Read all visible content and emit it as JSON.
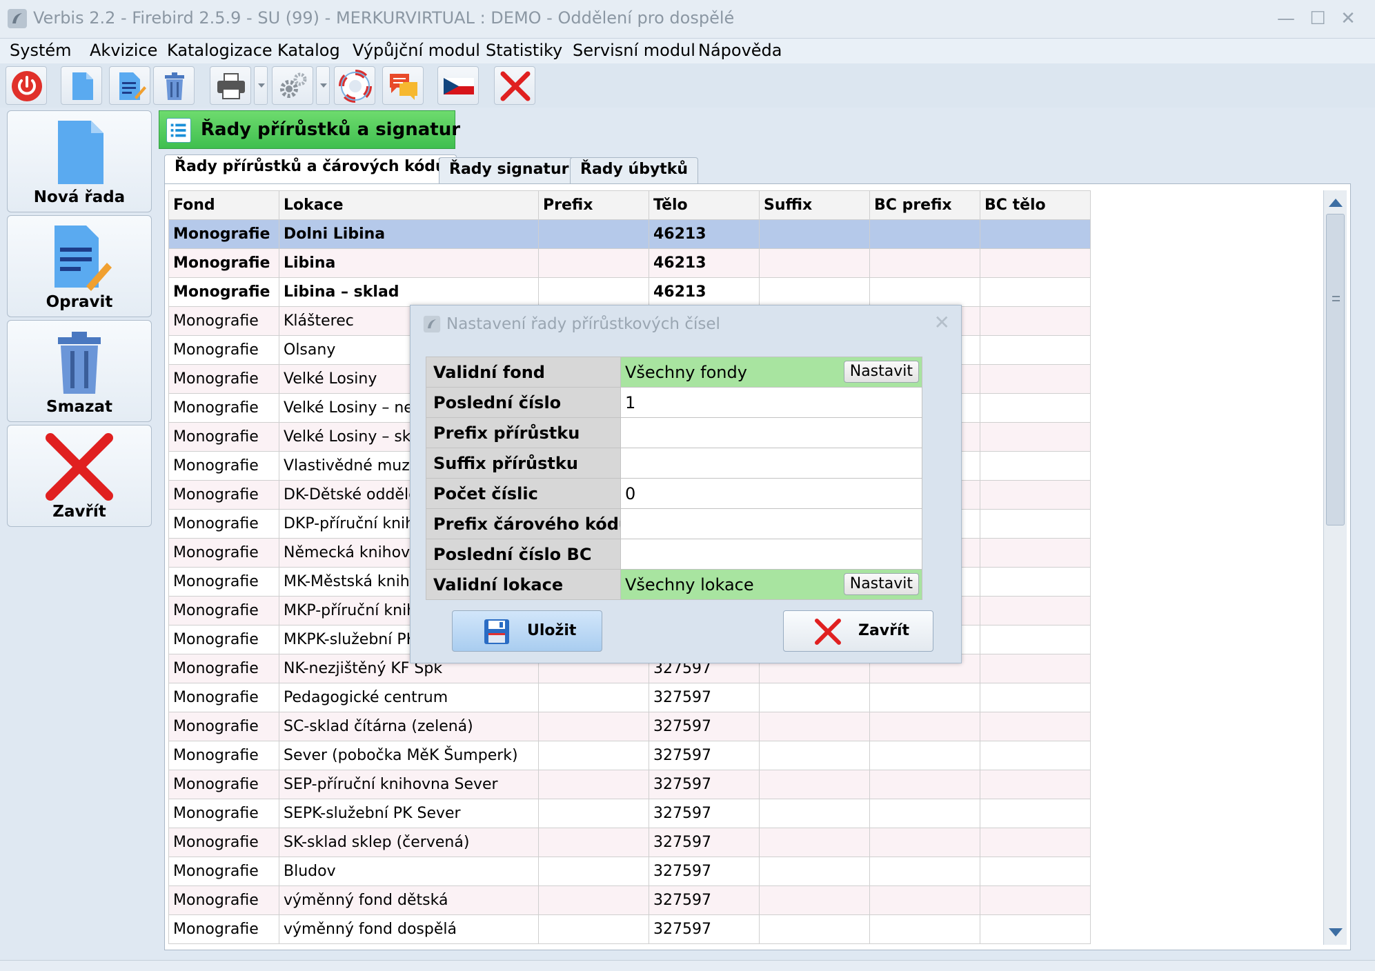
{
  "window": {
    "title": "Verbis 2.2 - Firebird 2.5.9 - SU (99) - MERKURVIRTUAL : DEMO - Oddělení pro dospělé",
    "minimize": "—",
    "maximize": "☐",
    "close": "✕"
  },
  "menu": [
    "Systém",
    "Akvizice",
    "Katalogizace",
    "Katalog",
    "Výpůjční modul",
    "Statistiky",
    "Servisní modul",
    "Nápověda"
  ],
  "side_buttons": {
    "new": "Nová řada",
    "edit": "Opravit",
    "delete": "Smazat",
    "close": "Zavřít"
  },
  "section_title": "Řady přírůstků a signatur",
  "tabs": [
    "Řady přírůstků a čárových kódů",
    "Řady signatur",
    "Řady úbytků"
  ],
  "grid": {
    "columns": [
      "Fond",
      "Lokace",
      "Prefix",
      "Tělo",
      "Suffix",
      "BC prefix",
      "BC tělo"
    ],
    "rows": [
      [
        "Monografie",
        "Dolni Libina",
        "",
        "46213",
        "",
        "",
        ""
      ],
      [
        "Monografie",
        "Libina",
        "",
        "46213",
        "",
        "",
        ""
      ],
      [
        "Monografie",
        "Libina – sklad",
        "",
        "46213",
        "",
        "",
        ""
      ],
      [
        "Monografie",
        "Klášterec",
        "",
        "",
        "",
        "",
        ""
      ],
      [
        "Monografie",
        "Olsany",
        "",
        "",
        "",
        "",
        ""
      ],
      [
        "Monografie",
        "Velké Losiny",
        "",
        "",
        "",
        "",
        ""
      ],
      [
        "Monografie",
        "Velké Losiny – nezj",
        "",
        "",
        "",
        "",
        ""
      ],
      [
        "Monografie",
        "Velké Losiny – sklad",
        "",
        "",
        "",
        "",
        ""
      ],
      [
        "Monografie",
        "Vlastivědné muzeum",
        "",
        "",
        "",
        "",
        ""
      ],
      [
        "Monografie",
        "DK-Dětské oddělen",
        "",
        "",
        "",
        "",
        ""
      ],
      [
        "Monografie",
        "DKP-příruční knihov",
        "",
        "",
        "",
        "",
        ""
      ],
      [
        "Monografie",
        "Německá knihovna",
        "",
        "",
        "",
        "",
        ""
      ],
      [
        "Monografie",
        "MK-Městská knihov",
        "",
        "",
        "",
        "",
        ""
      ],
      [
        "Monografie",
        "MKP-příruční knihov",
        "",
        "",
        "",
        "",
        ""
      ],
      [
        "Monografie",
        "MKPK-služební PK (",
        "",
        "",
        "",
        "",
        ""
      ],
      [
        "Monografie",
        "NK-nezjištěný KF Špk",
        "",
        "327597",
        "",
        "",
        ""
      ],
      [
        "Monografie",
        "Pedagogické centrum",
        "",
        "327597",
        "",
        "",
        ""
      ],
      [
        "Monografie",
        "SC-sklad čítárna (zelená)",
        "",
        "327597",
        "",
        "",
        ""
      ],
      [
        "Monografie",
        "Sever (pobočka MěK Šumperk)",
        "",
        "327597",
        "",
        "",
        ""
      ],
      [
        "Monografie",
        "SEP-příruční knihovna Sever",
        "",
        "327597",
        "",
        "",
        ""
      ],
      [
        "Monografie",
        "SEPK-služební PK Sever",
        "",
        "327597",
        "",
        "",
        ""
      ],
      [
        "Monografie",
        "SK-sklad sklep (červená)",
        "",
        "327597",
        "",
        "",
        ""
      ],
      [
        "Monografie",
        "Bludov",
        "",
        "327597",
        "",
        "",
        ""
      ],
      [
        "Monografie",
        "výměnný fond dětská",
        "",
        "327597",
        "",
        "",
        ""
      ],
      [
        "Monografie",
        "výměnný fond dospělá",
        "",
        "327597",
        "",
        "",
        ""
      ]
    ]
  },
  "dialog": {
    "title": "Nastavení řady přírůstkových čísel",
    "fields": [
      {
        "label": "Validní fond",
        "value": "Všechny fondy",
        "button": "Nastavit"
      },
      {
        "label": "Poslední číslo",
        "value": "1"
      },
      {
        "label": "Prefix přírůstku",
        "value": ""
      },
      {
        "label": "Suffix přírůstku",
        "value": ""
      },
      {
        "label": "Počet číslic",
        "value": "0"
      },
      {
        "label": "Prefix čárového kódu",
        "value": ""
      },
      {
        "label": "Poslední číslo BC",
        "value": ""
      },
      {
        "label": "Validní lokace",
        "value": "Všechny lokace",
        "button": "Nastavit"
      }
    ],
    "save_label": "Uložit",
    "close_label": "Zavřít"
  },
  "colors": {
    "selected_row": "#b5c9ea",
    "section_tab": "#3fbf4f",
    "green_field": "#a8e4a0"
  }
}
